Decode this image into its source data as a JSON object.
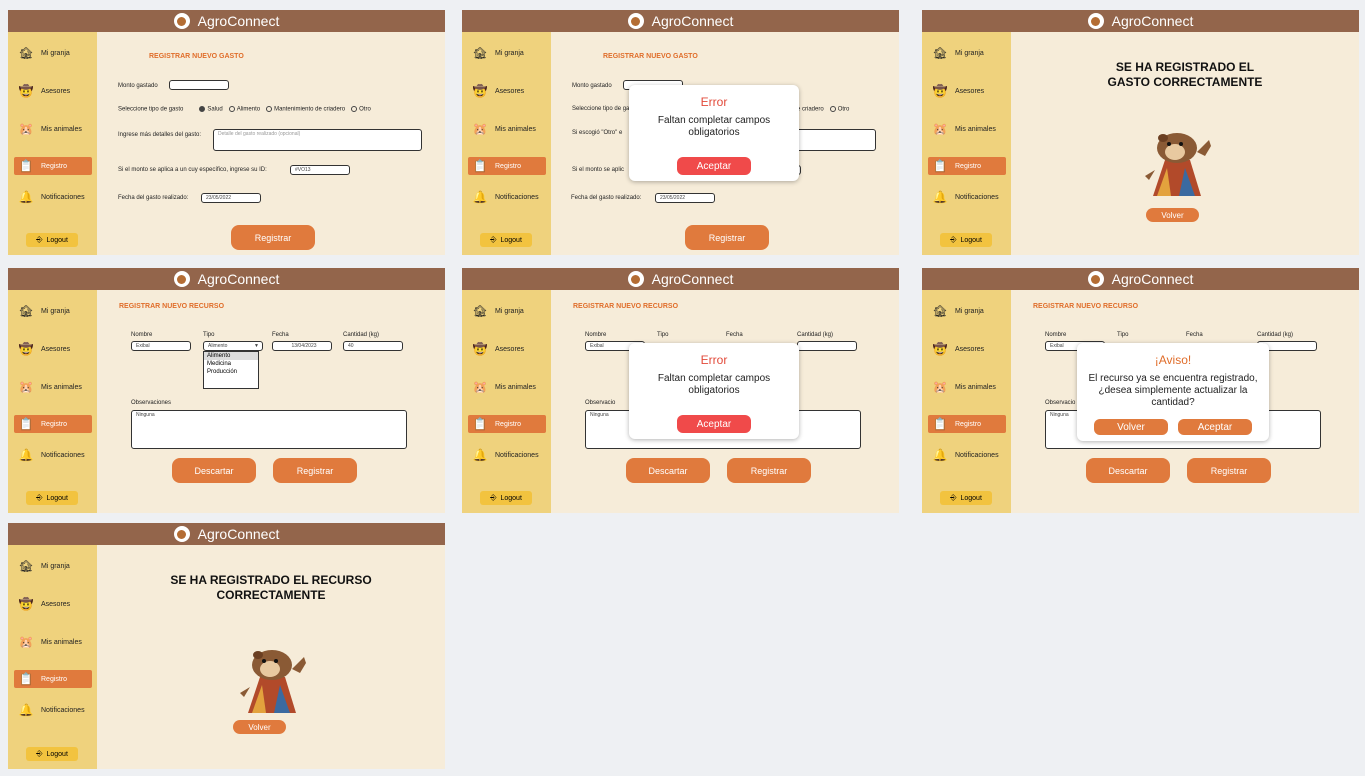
{
  "app": {
    "title": "AgroConnect"
  },
  "sidebar": {
    "items": [
      {
        "label": "Mi granja"
      },
      {
        "label": "Asesores"
      },
      {
        "label": "Mis animales"
      },
      {
        "label": "Registro"
      },
      {
        "label": "Notificaciones"
      }
    ],
    "logout": "Logout"
  },
  "gasto": {
    "title": "REGISTRAR NUEVO GASTO",
    "monto_label": "Monto gastado",
    "tipo_label": "Seleccione tipo de gasto",
    "tipo_options": [
      "Salud",
      "Alimento",
      "Mantenimiento de criadero",
      "Otro"
    ],
    "detalles_label": "Ingrese más detalles del gasto:",
    "detalles_placeholder": "Detalle del gasto realizado (opcional)",
    "otro_label": "Si escogió \"Otro\" e",
    "cuy_label": "Si el monto se aplica a un cuy específico, ingrese su ID:",
    "cuy_label_short": "Si el monto se aplic",
    "cuy_id": "#VO13",
    "fecha_label": "Fecha del gasto realizado:",
    "fecha": "23/05/2022",
    "registrar": "Registrar"
  },
  "error_modal": {
    "title": "Error",
    "message": "Faltan completar campos obligatorios",
    "button": "Aceptar"
  },
  "success_gasto": {
    "message": "SE HA REGISTRADO EL GASTO CORRECTAMENTE",
    "button": "Volver"
  },
  "recurso": {
    "title": "REGISTRAR NUEVO RECURSO",
    "nombre_label": "Nombre",
    "tipo_label": "Tipo",
    "fecha_label": "Fecha",
    "cantidad_label": "Cantidad (kg)",
    "nombre": "Exibal",
    "tipo": "Alimento",
    "fecha": "13/04/2023",
    "cantidad": "40",
    "tipo_options": [
      "Alimento",
      "Medicina",
      "Producción"
    ],
    "obs_label": "Observaciones",
    "obs_label_short": "Observacio",
    "obs": "Ninguna",
    "descartar": "Descartar",
    "registrar": "Registrar",
    "cantidad_partial": "0"
  },
  "aviso_modal": {
    "title": "¡Aviso!",
    "message": "El recurso ya se encuentra registrado, ¿desea simplemente actualizar la cantidad?",
    "volver": "Volver",
    "aceptar": "Aceptar"
  },
  "success_recurso": {
    "message": "SE HA REGISTRADO EL RECURSO CORRECTAMENTE",
    "button": "Volver"
  },
  "colors": {
    "topbar": "#93654b",
    "sidebar": "#efd27d",
    "content": "#f6ecd9",
    "accent": "#e07a3d",
    "error": "#f04a4a"
  },
  "icons": [
    "barn-icon",
    "farmer-icon",
    "guinea-pig-icon",
    "clipboard-icon",
    "bell-icon",
    "logout-icon",
    "dropdown-arrow-icon"
  ]
}
